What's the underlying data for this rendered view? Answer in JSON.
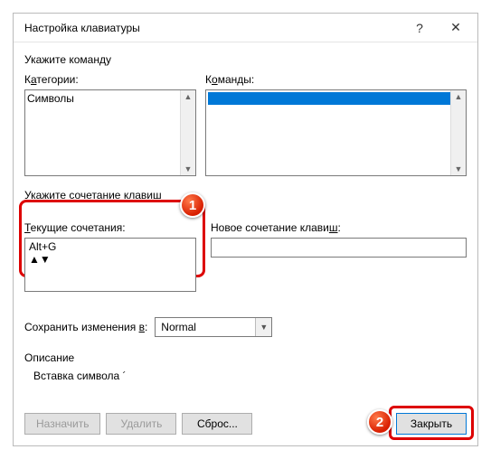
{
  "window": {
    "title": "Настройка клавиатуры",
    "help": "?",
    "close": "✕"
  },
  "section_command": "Укажите команду",
  "categories": {
    "label_pre": "К",
    "label_u": "а",
    "label_post": "тегории:",
    "item": "Символы"
  },
  "commands": {
    "label_pre": "К",
    "label_u": "о",
    "label_post": "манды:"
  },
  "section_keys": "Укажите сочетание клавиш",
  "current": {
    "label_pre": "",
    "label_u": "Т",
    "label_post": "екущие сочетания:",
    "value": "Alt+G"
  },
  "newcombo": {
    "label_pre": "Новое сочетание клави",
    "label_u": "ш",
    "label_post": ":",
    "value": ""
  },
  "save": {
    "label_pre": "Сохранить изменения ",
    "label_u": "в",
    "label_post": ":",
    "value": "Normal"
  },
  "description": {
    "heading": "Описание",
    "text": "Вставка символа ´"
  },
  "buttons": {
    "assign": "Назначить",
    "delete": "Удалить",
    "reset": "Сброс...",
    "close": "Закрыть"
  },
  "badges": {
    "one": "1",
    "two": "2"
  }
}
